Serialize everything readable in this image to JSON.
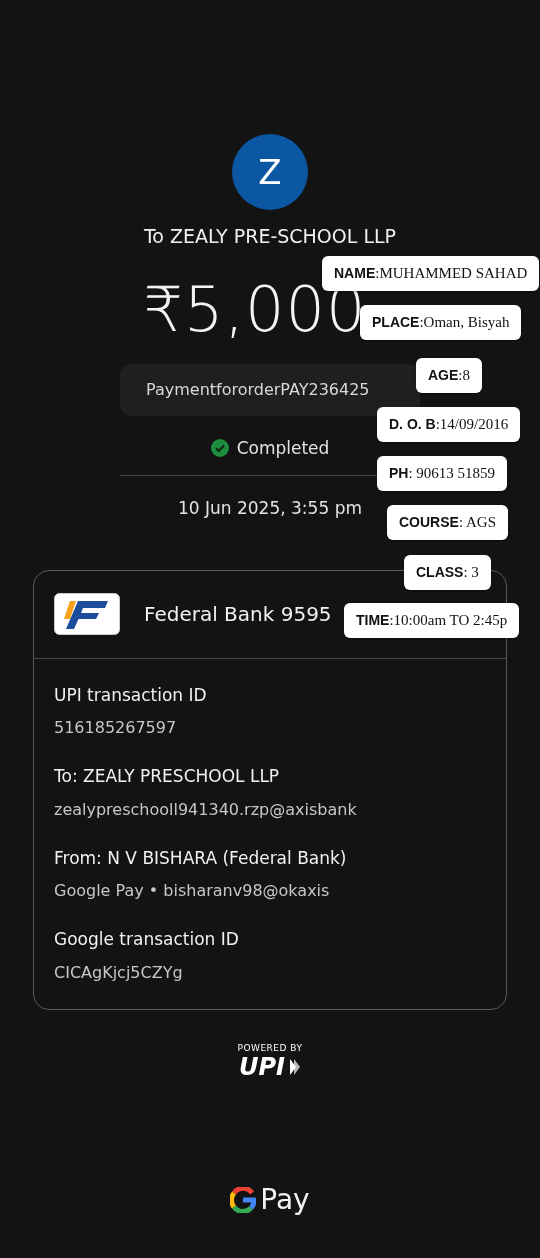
{
  "avatar": {
    "initial": "Z"
  },
  "payee": "To ZEALY PRE-SCHOOL LLP",
  "amount": "₹5,000",
  "note": "PaymentfororderPAY236425",
  "status": {
    "label": "Completed",
    "completed": true
  },
  "datetime": "10 Jun 2025, 3:55 pm",
  "account": {
    "bank": "Federal Bank 9595"
  },
  "details": [
    {
      "label": "UPI transaction ID",
      "value": "516185267597"
    },
    {
      "label": "To: ZEALY PRESCHOOL LLP",
      "value": "zealypreschooll941340.rzp@axisbank"
    },
    {
      "label": "From: N V BISHARA (Federal Bank)",
      "value": "Google Pay • bisharanv98@okaxis"
    },
    {
      "label": "Google transaction ID",
      "value": "CICAgKjcj5CZYg"
    }
  ],
  "powered_by": {
    "caption": "POWERED BY",
    "logo": "UPI"
  },
  "footer_brand": "Pay",
  "overlay_labels": [
    {
      "text": "**NAME**:MUHAMMED SAHAD"
    },
    {
      "text": "**PLACE**:Oman, Bisyah"
    },
    {
      "text": "**AGE**:8"
    },
    {
      "text": "**D. O. B**:14/09/2016"
    },
    {
      "text": "**PH**: 90613 51859"
    },
    {
      "text": "**COURSE**: AGS"
    },
    {
      "text": "**CLASS**:  3"
    },
    {
      "text": "**TIME**:10:00am TO 2:45p"
    }
  ]
}
